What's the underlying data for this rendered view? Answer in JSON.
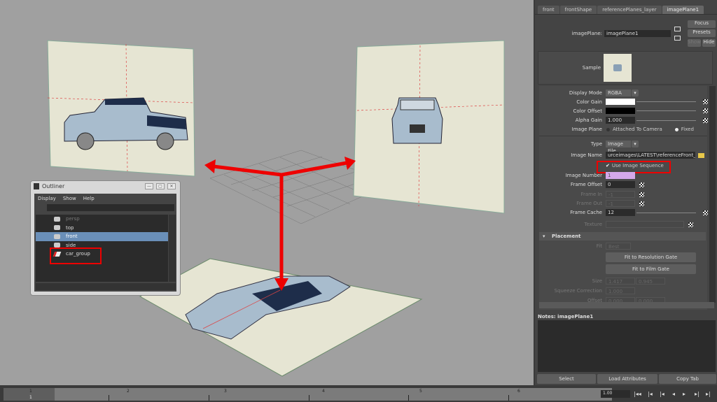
{
  "colors": {
    "viewport": "#a0a0a0",
    "panel": "#444444",
    "accent_red": "#ee0000",
    "selection": "#6a8fb8",
    "plane": "#e6e5d3"
  },
  "outliner": {
    "title": "Outliner",
    "menu": [
      "Display",
      "Show",
      "Help"
    ],
    "items": [
      {
        "label": "persp",
        "icon": "camera-icon",
        "state": "dim"
      },
      {
        "label": "top",
        "icon": "camera-icon",
        "state": "normal"
      },
      {
        "label": "front",
        "icon": "camera-icon",
        "state": "selected"
      },
      {
        "label": "side",
        "icon": "camera-icon",
        "state": "normal"
      },
      {
        "label": "car_group",
        "icon": "group-icon",
        "state": "highlighted"
      }
    ]
  },
  "attribute_editor": {
    "tabs": [
      "front",
      "frontShape",
      "referencePlanes_layer",
      "imagePlane1"
    ],
    "active_tab": "imagePlane1",
    "node_label": "imagePlane:",
    "node_value": "imagePlane1",
    "buttons": {
      "focus": "Focus",
      "presets": "Presets",
      "show": "Show",
      "hide": "Hide"
    },
    "sample_label": "Sample",
    "display_mode": {
      "label": "Display Mode",
      "value": "RGBA"
    },
    "color_gain": {
      "label": "Color Gain",
      "color": "#ffffff"
    },
    "color_offset": {
      "label": "Color Offset",
      "color": "#000000"
    },
    "alpha_gain": {
      "label": "Alpha Gain",
      "value": "1.000"
    },
    "image_plane": {
      "label": "Image Plane",
      "option1": "Attached To Camera",
      "option2": "Fixed",
      "selected": "Fixed"
    },
    "type": {
      "label": "Type",
      "value": "Image File"
    },
    "image_name": {
      "label": "Image Name",
      "value": "urceimages\\LATEST\\referenceFront_v1.tif"
    },
    "use_image_sequence": {
      "label": "Use Image Sequence",
      "checked": true
    },
    "image_number": {
      "label": "Image Number",
      "value": "1"
    },
    "frame_offset": {
      "label": "Frame Offset",
      "value": "0"
    },
    "frame_in": {
      "label": "Frame In",
      "value": "-1"
    },
    "frame_out": {
      "label": "Frame Out",
      "value": "-1"
    },
    "frame_cache": {
      "label": "Frame Cache",
      "value": "12"
    },
    "texture": {
      "label": "Texture"
    },
    "placement": {
      "title": "Placement",
      "fit_label": "Fit",
      "fit_value": "Best",
      "fit_resolution": "Fit to Resolution Gate",
      "fit_film": "Fit to Film Gate",
      "size_label": "Size",
      "size": [
        "1.417",
        "0.945"
      ],
      "squeeze_label": "Squeeze Correction",
      "squeeze": "1.000",
      "offset_label": "Offset",
      "offset": [
        "0.000",
        "0.000"
      ]
    },
    "notes_label": "Notes: imagePlane1",
    "bottom_buttons": [
      "Select",
      "Load Attributes",
      "Copy Tab"
    ]
  },
  "timeline": {
    "ticks": [
      "1",
      "2",
      "3",
      "4",
      "5",
      "6"
    ],
    "current_frame": "1",
    "current_time": "1.00",
    "playback": [
      "go-start-icon",
      "step-back-key-icon",
      "step-back-icon",
      "play-back-icon",
      "play-forward-icon",
      "step-forward-icon",
      "go-end-icon"
    ]
  }
}
